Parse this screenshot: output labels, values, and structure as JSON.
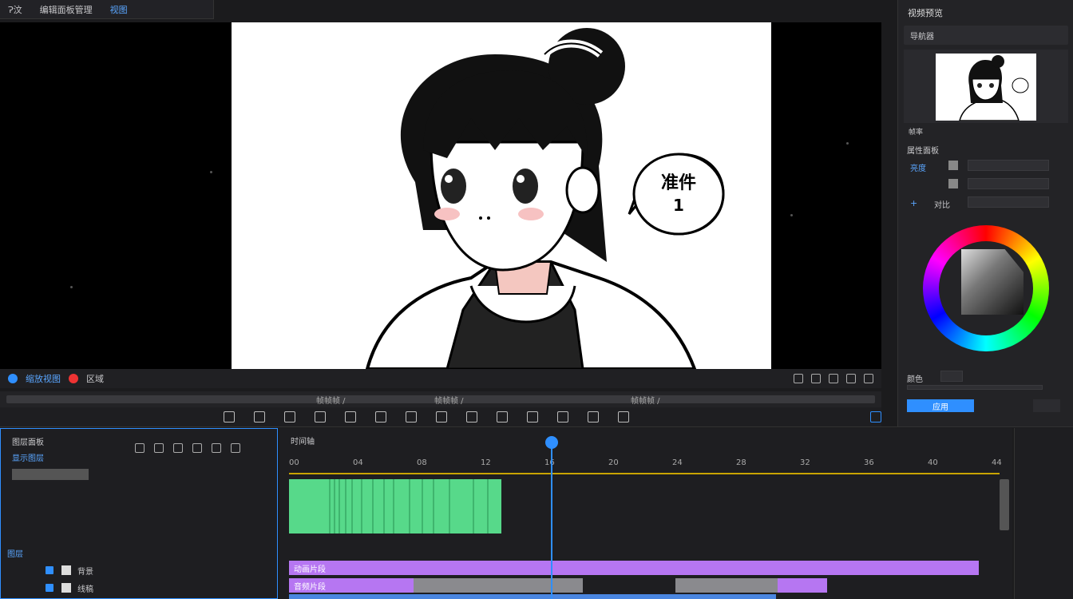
{
  "topbar": {
    "items": [
      "Ɂ汶",
      "编辑面板管理",
      "视图"
    ],
    "active_index": 2
  },
  "viewer": {
    "speech_text_line1": "准件",
    "speech_text_line2": "1"
  },
  "viewer_controls": {
    "left_label": "缩放视图",
    "mid_label": "区域"
  },
  "scrub": {
    "labels": [
      "帧帧帧 /",
      "帧帧帧 /",
      "帧帧帧 /"
    ]
  },
  "right_panel": {
    "title": "视频预览",
    "navigator_label": "导航器",
    "thumb_caption": "帧率",
    "props_title": "属性面板",
    "row1_label": "亮度",
    "row3_label": "对比",
    "color_title": "颜色",
    "apply_label": "应用"
  },
  "left_panel": {
    "title": "图层面板",
    "subtitle": "显示图层",
    "layers_header": "图层",
    "layer1": "背景",
    "layer2": "线稿"
  },
  "timeline": {
    "track_label": "时间轴",
    "ticks": [
      "00",
      "04",
      "08",
      "12",
      "16",
      "20",
      "24",
      "28",
      "32",
      "36",
      "40",
      "44"
    ],
    "clip1": "动画片段",
    "clip2": "音频片段"
  },
  "colors": {
    "accent": "#2f8fff",
    "green_clip": "#57d98a",
    "purple_clip": "#b676f2",
    "ruler": "#c8a400"
  }
}
